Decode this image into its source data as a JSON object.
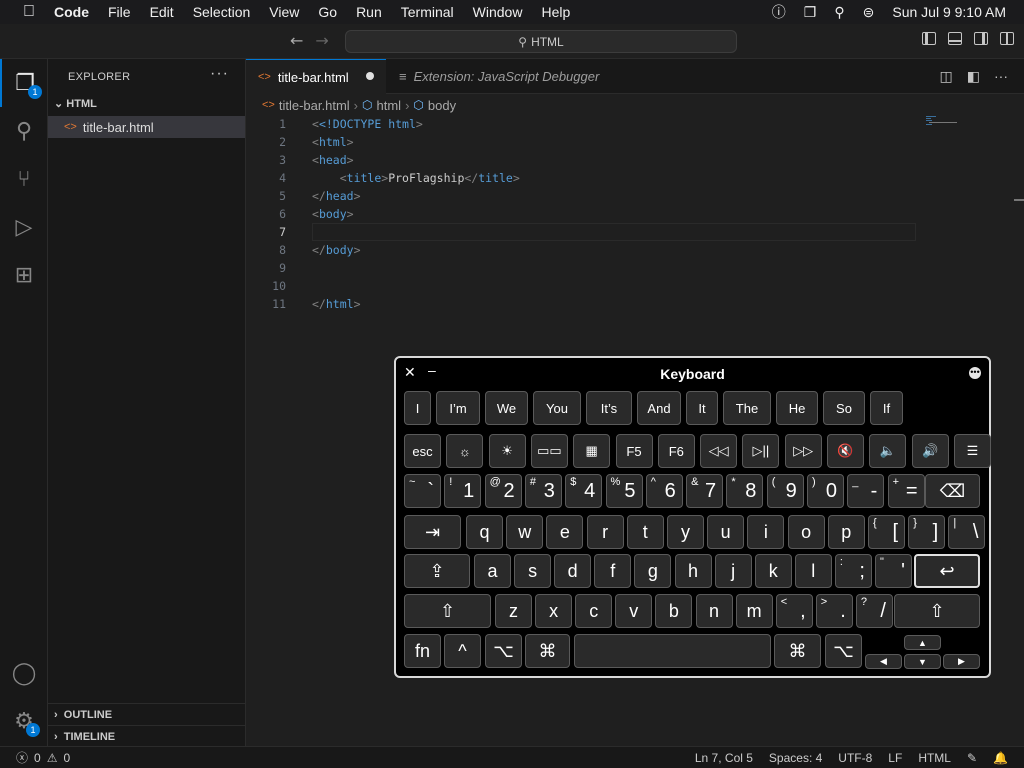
{
  "menubar": {
    "app": "Code",
    "items": [
      "File",
      "Edit",
      "Selection",
      "View",
      "Go",
      "Run",
      "Terminal",
      "Window",
      "Help"
    ],
    "datetime": "Sun Jul 9  9:10 AM"
  },
  "titlebar": {
    "search_label": "HTML"
  },
  "activity": {
    "explorer_badge": "1",
    "manage_badge": "1"
  },
  "sidebar": {
    "title": "EXPLORER",
    "more": "···",
    "folder": "HTML",
    "file": "title-bar.html",
    "outline": "OUTLINE",
    "timeline": "TIMELINE"
  },
  "tabs": {
    "active": "title-bar.html",
    "inactive": "Extension: JavaScript Debugger"
  },
  "breadcrumb": {
    "file": "title-bar.html",
    "html": "html",
    "body": "body"
  },
  "editor": {
    "lines": [
      {
        "n": "1"
      },
      {
        "n": "2"
      },
      {
        "n": "3"
      },
      {
        "n": "4"
      },
      {
        "n": "5"
      },
      {
        "n": "6"
      },
      {
        "n": "7"
      },
      {
        "n": "8"
      },
      {
        "n": "9"
      },
      {
        "n": "10"
      },
      {
        "n": "11"
      }
    ],
    "doctype": "<!DOCTYPE",
    "doctype_html": "html",
    "title_text": "ProFlagship"
  },
  "status": {
    "errors": "0",
    "warnings": "0",
    "position": "Ln 7, Col 5",
    "spaces": "Spaces: 4",
    "encoding": "UTF-8",
    "eol": "LF",
    "language": "HTML"
  },
  "keyboard": {
    "title": "Keyboard",
    "suggestions": [
      "I",
      "I’m",
      "We",
      "You",
      "It’s",
      "And",
      "It",
      "The",
      "He",
      "So",
      "If"
    ],
    "fn_row": [
      "esc",
      "☼",
      "☀",
      "▭▭",
      "▦",
      "F5",
      "F6",
      "◁◁",
      "▷||",
      "▷▷",
      "🔇",
      "🔈",
      "🔊",
      "☰"
    ],
    "num_row": [
      {
        "s": "~",
        "m": "`"
      },
      {
        "s": "!",
        "m": "1"
      },
      {
        "s": "@",
        "m": "2"
      },
      {
        "s": "#",
        "m": "3"
      },
      {
        "s": "$",
        "m": "4"
      },
      {
        "s": "%",
        "m": "5"
      },
      {
        "s": "^",
        "m": "6"
      },
      {
        "s": "&",
        "m": "7"
      },
      {
        "s": "*",
        "m": "8"
      },
      {
        "s": "(",
        "m": "9"
      },
      {
        "s": ")",
        "m": "0"
      },
      {
        "s": "_",
        "m": "-"
      },
      {
        "s": "+",
        "m": "="
      }
    ],
    "delete": "⌫",
    "tab": "⇥",
    "row_q": [
      "q",
      "w",
      "e",
      "r",
      "t",
      "y",
      "u",
      "i",
      "o",
      "p"
    ],
    "row_q_extra": [
      {
        "s": "{",
        "m": "["
      },
      {
        "s": "}",
        "m": "]"
      },
      {
        "s": "|",
        "m": "\\"
      }
    ],
    "caps": "⇪",
    "row_a": [
      "a",
      "s",
      "d",
      "f",
      "g",
      "h",
      "j",
      "k",
      "l"
    ],
    "row_a_extra": [
      {
        "s": ":",
        "m": ";"
      },
      {
        "s": "\"",
        "m": "'"
      }
    ],
    "return": "↩",
    "shift": "⇧",
    "row_z": [
      "z",
      "x",
      "c",
      "v",
      "b",
      "n",
      "m"
    ],
    "row_z_extra": [
      {
        "s": "<",
        "m": ","
      },
      {
        "s": ">",
        "m": "."
      },
      {
        "s": "?",
        "m": "/"
      }
    ],
    "fn": "fn",
    "ctrl": "^",
    "opt": "⌥",
    "cmd": "⌘",
    "arrows": [
      "▲",
      "◀",
      "▼",
      "▶"
    ]
  }
}
